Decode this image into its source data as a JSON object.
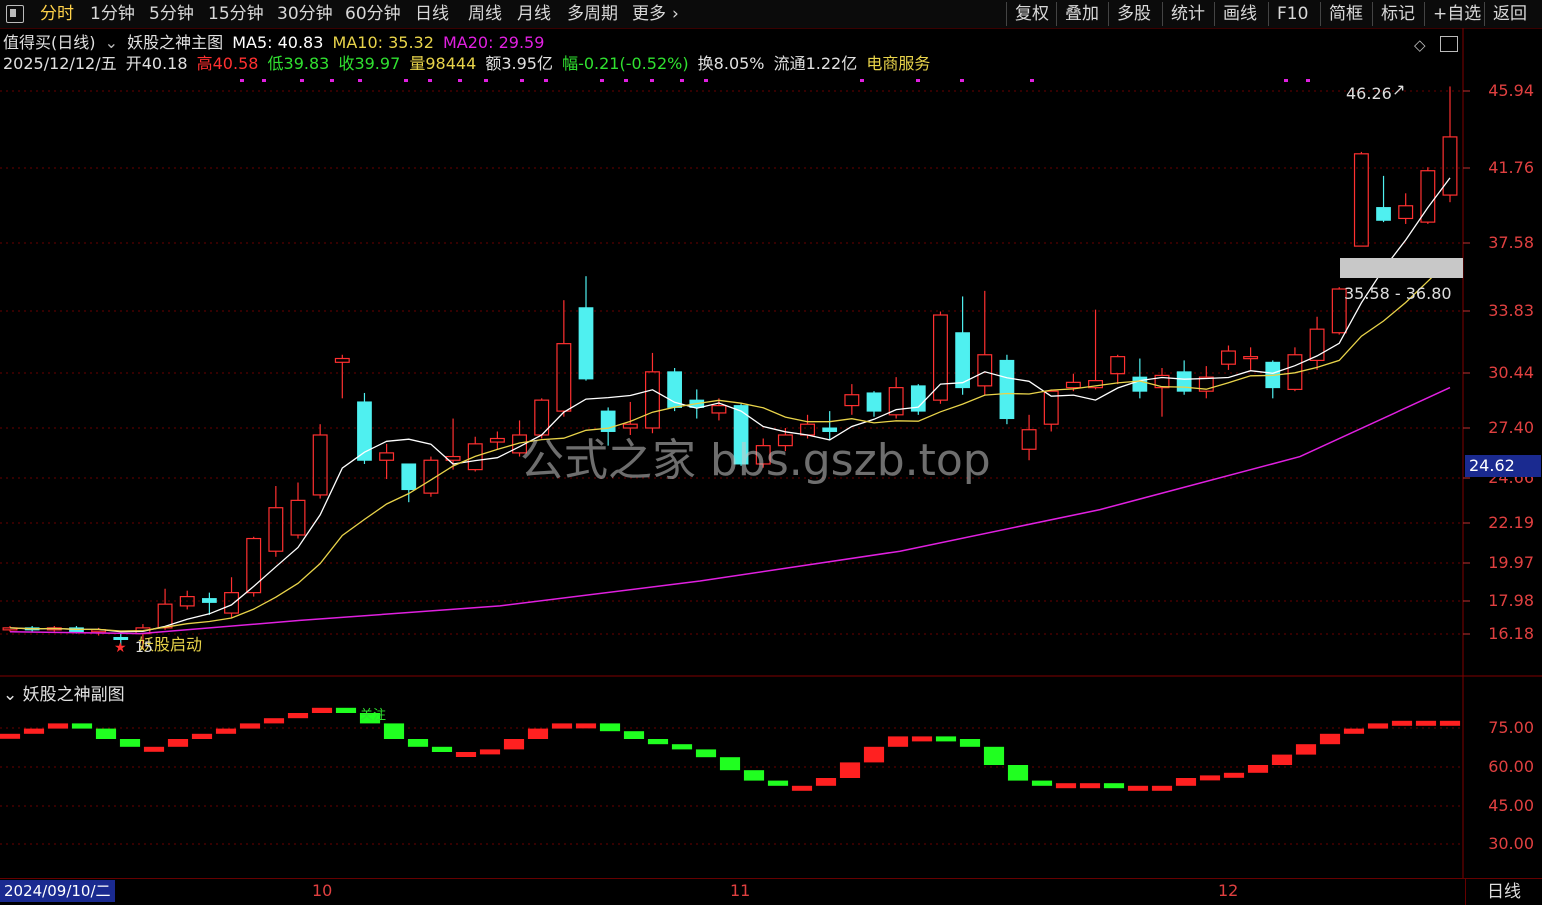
{
  "toolbar": {
    "left": [
      "分时",
      "1分钟",
      "5分钟",
      "15分钟",
      "30分钟",
      "60分钟",
      "日线",
      "周线",
      "月线",
      "多周期",
      "更多"
    ],
    "active": "分时",
    "right": [
      "复权",
      "叠加",
      "多股",
      "统计",
      "画线",
      "F10",
      "简框",
      "标记",
      "+自选",
      "返回"
    ]
  },
  "header": {
    "stock_name": "值得买(日线)",
    "indicator": "妖股之神主图",
    "ma5": "MA5: 40.83",
    "ma10": "MA10: 35.32",
    "ma20": "MA20: 29.59",
    "date": "2025/12/12/五",
    "open": "开40.18",
    "high": "高40.58",
    "low": "低39.83",
    "close": "收39.97",
    "volume": "量98444",
    "amount": "额3.95亿",
    "change": "幅-0.21(-0.52%)",
    "turnover": "换8.05%",
    "float": "流通1.22亿",
    "sector": "电商服务"
  },
  "price_axis": [
    "45.94",
    "41.76",
    "37.58",
    "33.83",
    "30.44",
    "27.40",
    "24.66",
    "22.19",
    "19.97",
    "17.98",
    "16.18"
  ],
  "indicator_axis": [
    "75.00",
    "60.00",
    "45.00",
    "30.00"
  ],
  "price_tag": "24.62",
  "annotations": {
    "high": "46.26",
    "range": "35.58 - 36.80",
    "start": "妖股启动",
    "start_low": "15",
    "signal": "关注"
  },
  "indicator_title": "妖股之神副图",
  "watermark": "公式之家 bbs.gszb.top",
  "bottom": {
    "date": "2024/09/10/二",
    "months": [
      "10",
      "11",
      "12"
    ],
    "period": "日线"
  },
  "colors": {
    "up": "#ff3030",
    "down": "#4ff0f0",
    "ma5": "#ffffff",
    "ma10": "#e8d34a",
    "ma20": "#e020e0",
    "bg": "#000000"
  }
}
